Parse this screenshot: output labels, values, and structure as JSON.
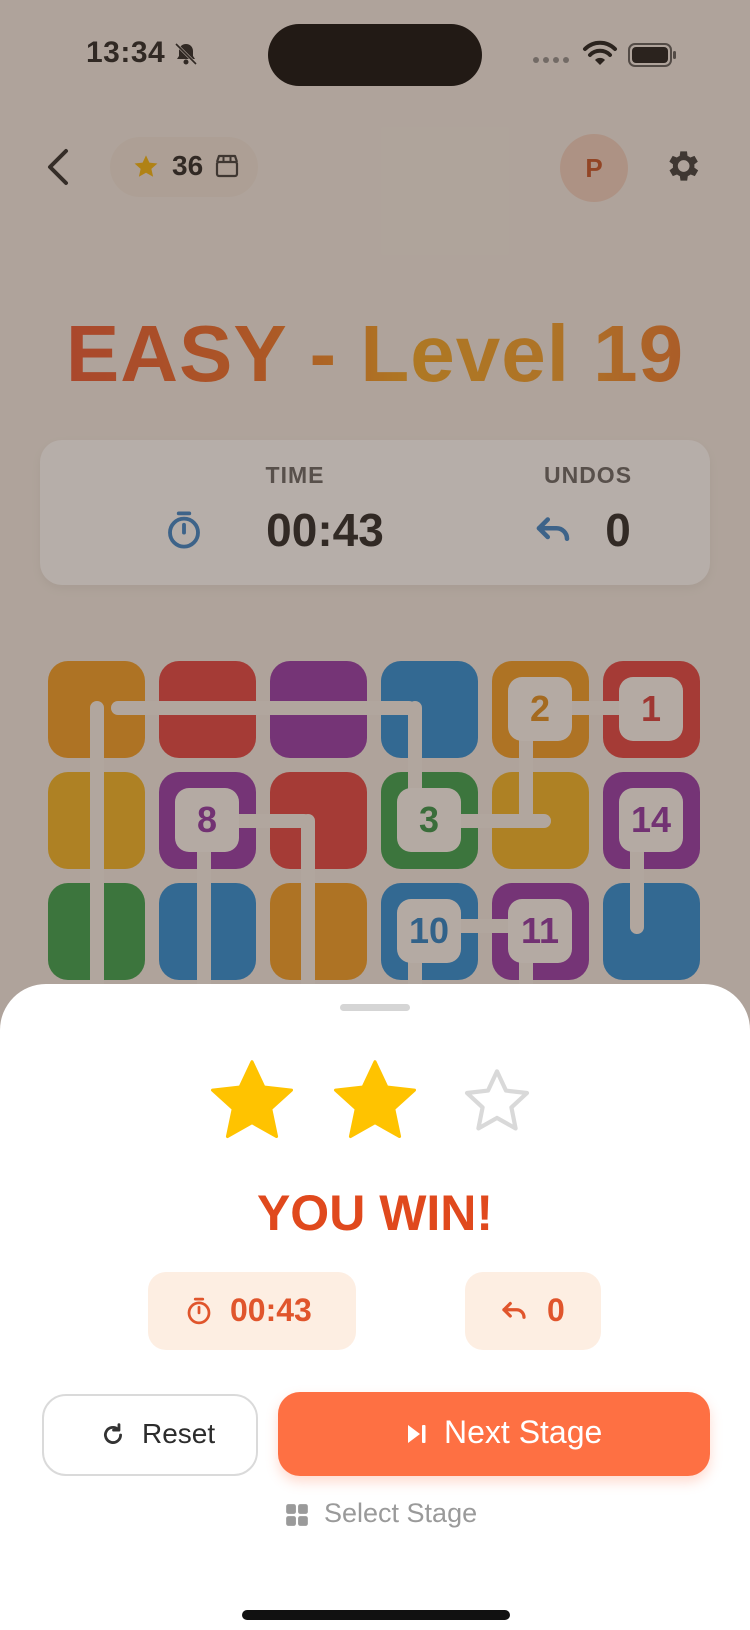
{
  "status_bar": {
    "time": "13:34"
  },
  "header": {
    "star_count": "36",
    "avatar_initial": "P"
  },
  "title": "EASY - Level 19",
  "stats": {
    "time_label": "TIME",
    "time_value": "00:43",
    "undos_label": "UNDOS",
    "undos_value": "0"
  },
  "board": {
    "node_labels": [
      "2",
      "1",
      "8",
      "3",
      "14",
      "10",
      "11"
    ]
  },
  "result": {
    "stars_earned": 2,
    "stars_total": 3,
    "headline": "YOU WIN!",
    "time_value": "00:43",
    "undos_value": "0"
  },
  "actions": {
    "reset_label": "Reset",
    "next_label": "Next Stage",
    "select_label": "Select Stage"
  },
  "colors": {
    "accent": "#fe7043",
    "headline": "#e0491d",
    "star_gold": "#ffc300",
    "star_empty": "#d9d9d9"
  }
}
